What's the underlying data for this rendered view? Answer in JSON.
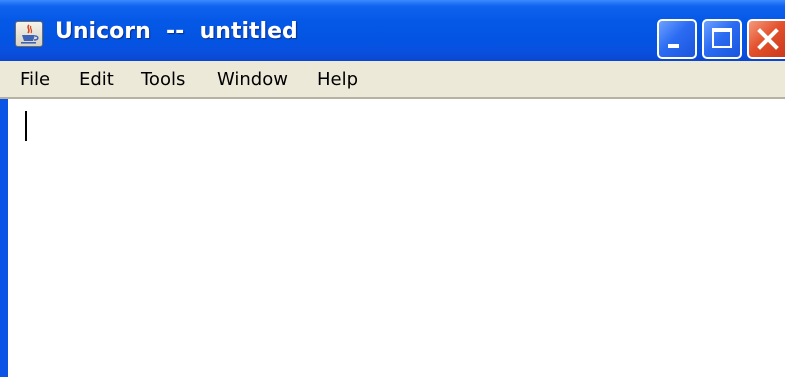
{
  "window": {
    "title": "Unicorn  --  untitled",
    "app_icon": "java-cup-icon",
    "controls": {
      "minimize_icon": "minimize-icon",
      "maximize_icon": "maximize-icon",
      "close_icon": "close-icon"
    }
  },
  "menubar": {
    "items": [
      {
        "label": "File"
      },
      {
        "label": "Edit"
      },
      {
        "label": "Tools"
      },
      {
        "label": "Window"
      },
      {
        "label": "Help"
      }
    ]
  },
  "editor": {
    "text": ""
  },
  "colors": {
    "titlebar": "#0554e3",
    "menubar": "#ece9d8",
    "close_button": "#e3502c",
    "editor_background": "#ffffff"
  }
}
